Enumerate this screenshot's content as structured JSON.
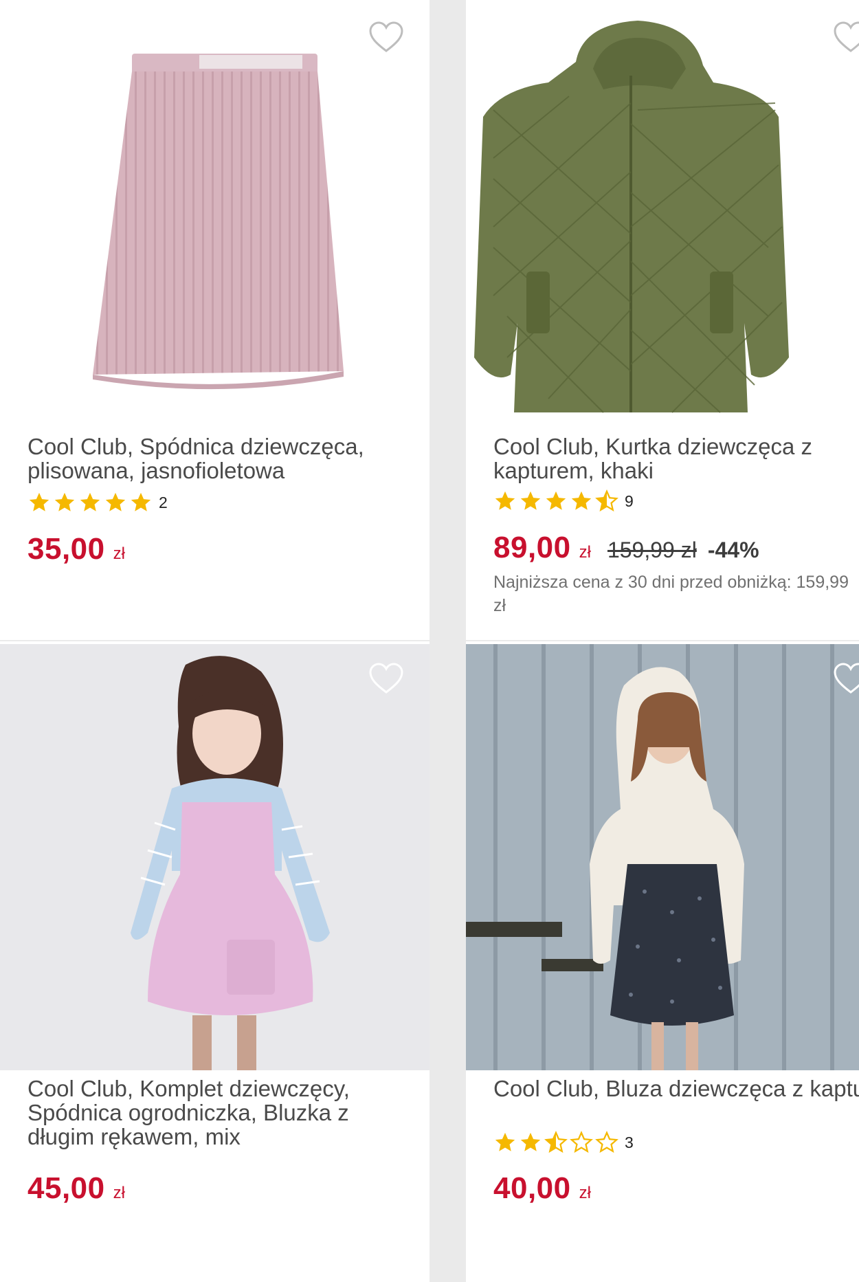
{
  "products": [
    {
      "title": "Cool Club, Spódnica dziewczęca, plisowana, jasnofioletowa",
      "rating": 5,
      "rating_count": "2",
      "price": "35,00",
      "currency": "zł",
      "image_icon": "pleated-skirt-image"
    },
    {
      "title": "Cool Club, Kurtka dziewczęca z kapturem, khaki",
      "rating": 4.5,
      "rating_count": "9",
      "price": "89,00",
      "currency": "zł",
      "old_price": "159,99 zł",
      "discount": "-44%",
      "lowest_price_note": "Najniższa cena z 30 dni przed obniżką: 159,99 zł",
      "image_icon": "quilted-jacket-image"
    },
    {
      "title": "Cool Club, Komplet dziewczęcy, Spódnica ogrodniczka, Bluzka z długim rękawem, mix",
      "price": "45,00",
      "currency": "zł",
      "image_icon": "girl-pinafore-dress-image"
    },
    {
      "title": "Cool Club, Bluza dziewczęca z kapturem, rozpinana, futrzana, ecru",
      "rating": 2.5,
      "rating_count": "3",
      "price": "40,00",
      "currency": "zł",
      "image_icon": "girl-fleece-hoodie-image"
    }
  ],
  "colors": {
    "price": "#c8102e",
    "star": "#f5b800",
    "text": "#4a4a4a",
    "background": "#eaeaea"
  },
  "icons": {
    "favorite": "heart-outline-icon",
    "star_full": "star-full-icon",
    "star_half": "star-half-icon",
    "star_empty": "star-empty-icon"
  }
}
